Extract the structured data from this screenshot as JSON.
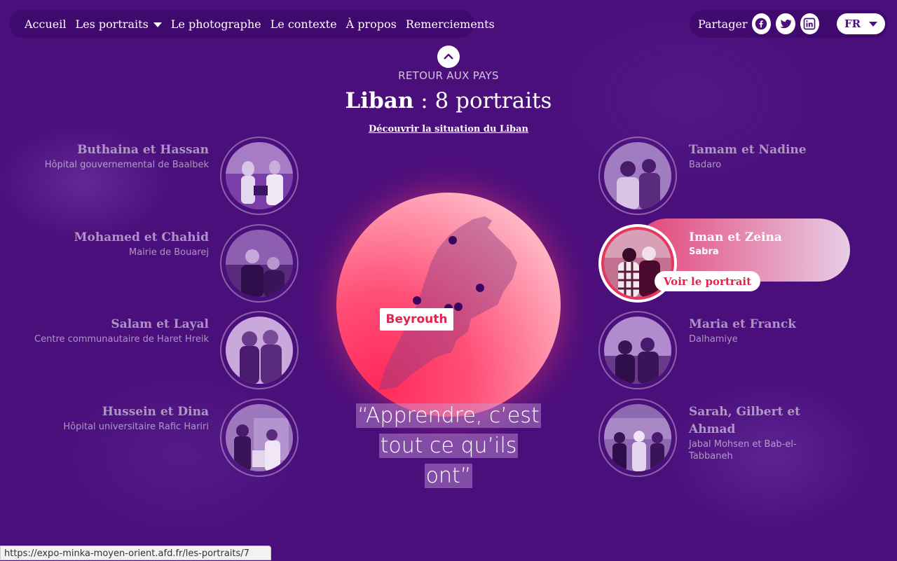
{
  "nav": {
    "items": [
      {
        "label": "Accueil",
        "has_caret": false
      },
      {
        "label": "Les portraits",
        "has_caret": true
      },
      {
        "label": "Le photographe",
        "has_caret": false
      },
      {
        "label": "Le contexte",
        "has_caret": false
      },
      {
        "label": "À propos",
        "has_caret": false
      },
      {
        "label": "Remerciements",
        "has_caret": false
      }
    ]
  },
  "share": {
    "label": "Partager",
    "icons": [
      "facebook-icon",
      "twitter-icon",
      "linkedin-icon"
    ]
  },
  "language": {
    "selected": "FR"
  },
  "back": {
    "label": "RETOUR AUX PAYS",
    "icon": "chevron-up-icon"
  },
  "country": {
    "name": "Liban",
    "suffix": " : 8 portraits"
  },
  "discover_link": "Découvrir la situation du Liban",
  "portraits_left": [
    {
      "name": "Buthaina et Hassan",
      "place": "Hôpital gouvernemental de Baalbek"
    },
    {
      "name": "Mohamed et Chahid",
      "place": "Mairie de Bouarej"
    },
    {
      "name": "Salam et Layal",
      "place": "Centre communautaire de Haret Hreik"
    },
    {
      "name": "Hussein et Dina",
      "place": "Hôpital universitaire Rafic Hariri"
    }
  ],
  "portraits_right": [
    {
      "name": "Tamam et Nadine",
      "place": "Badaro"
    },
    {
      "name": "Iman et Zeina",
      "place": "Sabra",
      "active": true
    },
    {
      "name": "Maria et Franck",
      "place": "Dalhamiye"
    },
    {
      "name": "Sarah, Gilbert et Ahmad",
      "place": "Jabal Mohsen et Bab-el-Tabbaneh"
    }
  ],
  "active_cta": "Voir le portrait",
  "map": {
    "city_label": "Beyrouth"
  },
  "quote": {
    "lines": [
      "“Apprendre, c’est",
      "tout ce qu’ils",
      "ont”"
    ]
  },
  "status_url": "https://expo-minka-moyen-orient.afd.fr/les-portraits/7",
  "colors": {
    "background": "#4b0f7c",
    "accent": "#e0234f",
    "dot": "#3a0660"
  }
}
